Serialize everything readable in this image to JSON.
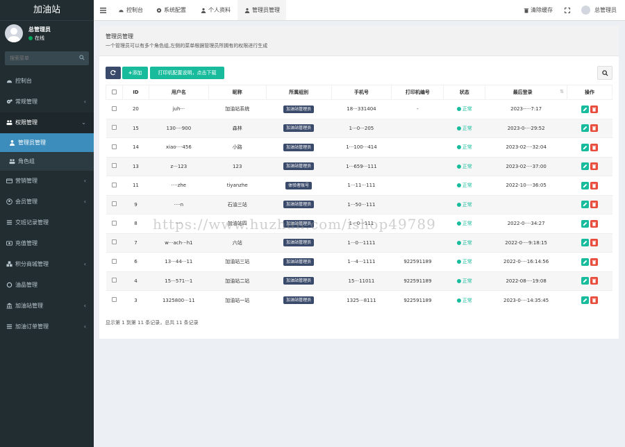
{
  "sidebar": {
    "brand": "加油站",
    "user": {
      "name": "总管理员",
      "status": "在线"
    },
    "search_placeholder": "搜索菜单",
    "items": [
      {
        "label": "控制台",
        "icon": "dashboard-icon",
        "chevron": ""
      },
      {
        "label": "常规管理",
        "icon": "cogs-icon",
        "chevron": "‹"
      },
      {
        "label": "权限管理",
        "icon": "users-icon",
        "chevron": "⌄"
      },
      {
        "label": "管理员管理",
        "icon": "user-icon",
        "chevron": ""
      },
      {
        "label": "角色组",
        "icon": "group-icon",
        "chevron": ""
      },
      {
        "label": "营销管理",
        "icon": "card-icon",
        "chevron": "‹"
      },
      {
        "label": "会员管理",
        "icon": "user-circle-icon",
        "chevron": "‹"
      },
      {
        "label": "交班记录管理",
        "icon": "list-icon",
        "chevron": ""
      },
      {
        "label": "充值管理",
        "icon": "money-icon",
        "chevron": ""
      },
      {
        "label": "积分商城管理",
        "icon": "cubes-icon",
        "chevron": "‹"
      },
      {
        "label": "油品管理",
        "icon": "circle-icon",
        "chevron": ""
      },
      {
        "label": "加油站管理",
        "icon": "bank-icon",
        "chevron": "‹"
      },
      {
        "label": "加油订单管理",
        "icon": "list-icon",
        "chevron": "‹"
      }
    ]
  },
  "topbar": {
    "tabs": [
      "控制台",
      "系统配置",
      "个人资料",
      "管理员管理"
    ],
    "clear_cache": "清除缓存",
    "user": "总管理员"
  },
  "panel": {
    "title": "管理员管理",
    "desc": "一个管理员可以有多个角色组,左侧的菜单根据管理员所拥有的权限进行生成",
    "add_label": "添加",
    "print_label": "打印机配置说明，点击下载",
    "columns": [
      "",
      "ID",
      "用户名",
      "昵称",
      "所属组别",
      "手机号",
      "打印机编号",
      "状态",
      "最后登录",
      "操作"
    ],
    "rows": [
      {
        "id": "20",
        "username": "juh···",
        "nickname": "加油站系统",
        "group": "加油站管理员",
        "phone": "18···331404",
        "printer": "-",
        "status": "正常",
        "login": "2023-····7:17"
      },
      {
        "id": "15",
        "username": "130····900",
        "nickname": "森林",
        "group": "加油站管理员",
        "phone": "1···0···205",
        "printer": "",
        "status": "正常",
        "login": "2023-0····29:52"
      },
      {
        "id": "14",
        "username": "xiao····456",
        "nickname": "小路",
        "group": "加油站管理员",
        "phone": "1···100···414",
        "printer": "",
        "status": "正常",
        "login": "2023-02····32:04"
      },
      {
        "id": "13",
        "username": "z···123",
        "nickname": "123",
        "group": "加油站管理员",
        "phone": "1···659···111",
        "printer": "",
        "status": "正常",
        "login": "2023-02····37:00"
      },
      {
        "id": "11",
        "username": "····zhe",
        "nickname": "tiyanzhe",
        "group": "体验者账号",
        "phone": "1···11···111",
        "printer": "",
        "status": "正常",
        "login": "2022-10····36:05"
      },
      {
        "id": "9",
        "username": "····n",
        "nickname": "石油三站",
        "group": "加油站管理员",
        "phone": "1···50···111",
        "printer": "",
        "status": "正常",
        "login": ""
      },
      {
        "id": "8",
        "username": "····",
        "nickname": "加油站四",
        "group": "加油站管理员",
        "phone": "1···0···111",
        "printer": "",
        "status": "正常",
        "login": "2022-0····34:27"
      },
      {
        "id": "7",
        "username": "w···ach···h1",
        "nickname": "六站",
        "group": "加油站管理员",
        "phone": "1···0···1111",
        "printer": "",
        "status": "正常",
        "login": "2022-0····9:18:15"
      },
      {
        "id": "6",
        "username": "13···44···11",
        "nickname": "加油站三站",
        "group": "加油站管理员",
        "phone": "1···4···1111",
        "printer": "922591189",
        "status": "正常",
        "login": "2022-0····16:14:56"
      },
      {
        "id": "4",
        "username": "15···571···1",
        "nickname": "加油站二站",
        "group": "加油站管理员",
        "phone": "15···11011",
        "printer": "922591189",
        "status": "正常",
        "login": "2022-08····19:08"
      },
      {
        "id": "3",
        "username": "1325800···11",
        "nickname": "加油站一站",
        "group": "加油站管理员",
        "phone": "1325···8111",
        "printer": "922591189",
        "status": "正常",
        "login": "2023-0····14:35:45"
      }
    ],
    "footer": "显示第 1 到第 11 条记录，总共 11 条记录"
  },
  "watermark": "https://www.huzhan.com/ishop49789"
}
